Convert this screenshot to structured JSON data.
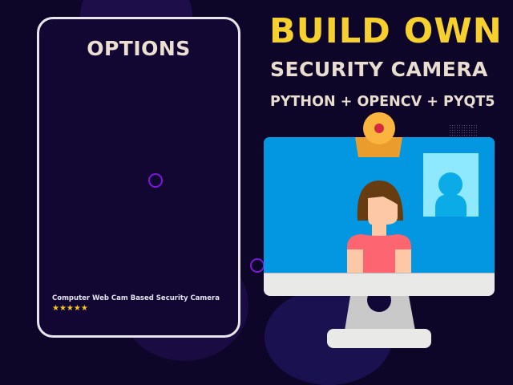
{
  "card": {
    "title": "OPTIONS",
    "caption": "Computer Web Cam Based Security Camera",
    "rating": "★★★★★"
  },
  "headline": {
    "line1": "BUILD OWN",
    "line2": "SECURITY CAMERA",
    "line3": "PYTHON + OPENCV + PYQT5"
  },
  "colors": {
    "background": "#0e0628",
    "title_yellow": "#f6d02e",
    "screen_blue": "#0397e2"
  }
}
